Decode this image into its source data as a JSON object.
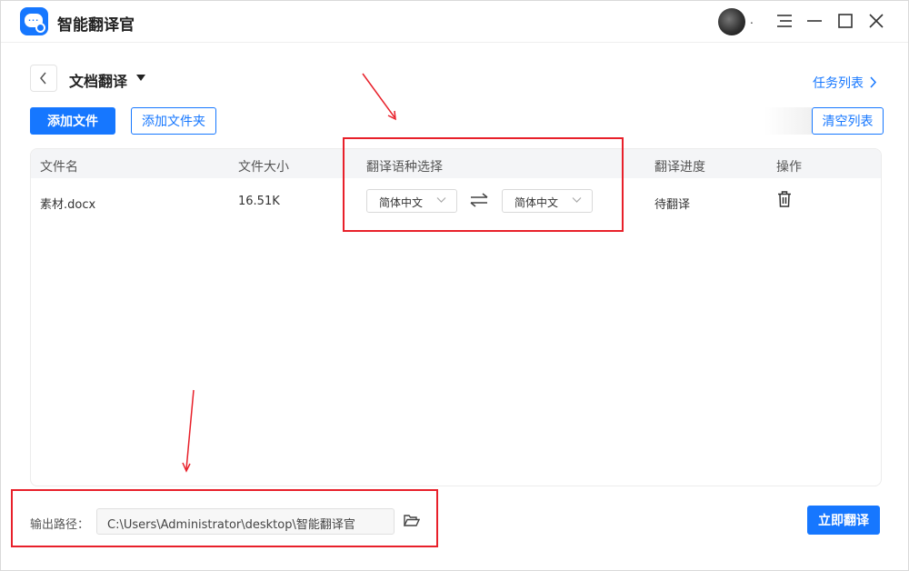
{
  "app": {
    "title": "智能翻译官",
    "avatar_suffix": "."
  },
  "header": {
    "page_title": "文档翻译",
    "task_list_label": "任务列表"
  },
  "toolbar": {
    "add_file_label": "添加文件",
    "add_folder_label": "添加文件夹",
    "clear_list_label": "清空列表"
  },
  "table": {
    "columns": {
      "file_name": "文件名",
      "file_size": "文件大小",
      "language": "翻译语种选择",
      "progress": "翻译进度",
      "actions": "操作"
    },
    "rows": [
      {
        "file_name": "素材.docx",
        "file_size": "16.51K",
        "source_lang": "简体中文",
        "target_lang": "简体中文",
        "progress": "待翻译"
      }
    ]
  },
  "footer": {
    "output_label": "输出路径：",
    "output_path": "C:\\Users\\Administrator\\desktop\\智能翻译官",
    "translate_button": "立即翻译"
  },
  "colors": {
    "accent": "#1677ff",
    "annotation": "#e8202a"
  },
  "icons": [
    "app-logo-icon",
    "back-chevron-icon",
    "caret-down-icon",
    "chevron-right-icon",
    "swap-arrows-icon",
    "trash-icon",
    "folder-open-icon",
    "menu-icon",
    "minimize-icon",
    "maximize-icon",
    "close-icon"
  ]
}
